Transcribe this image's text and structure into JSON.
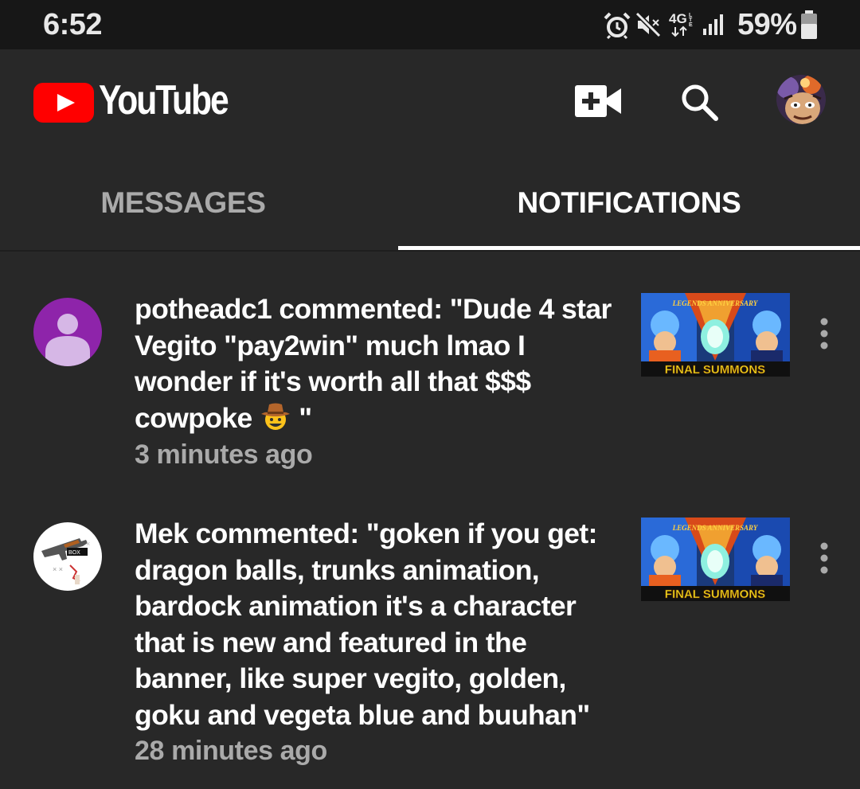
{
  "status_bar": {
    "time": "6:52",
    "network": "4G",
    "battery": "59%",
    "icons": [
      "alarm-icon",
      "mute-icon",
      "lte-icon",
      "signal-icon",
      "battery-icon"
    ]
  },
  "app_bar": {
    "brand": "YouTube",
    "icons": [
      "create-video-icon",
      "search-icon",
      "account-avatar"
    ]
  },
  "tabs": [
    {
      "label": "MESSAGES",
      "selected": false
    },
    {
      "label": "NOTIFICATIONS",
      "selected": true
    }
  ],
  "notifications": [
    {
      "text": "potheadc1 commented: \"Dude 4 star Vegito \"pay2win\" much lmao I wonder if it's worth all that $$$ cowpoke",
      "text_suffix": " \"",
      "emoji": "cowboy-face-emoji",
      "time": "3 minutes ago",
      "thumbnail_caption": "FINAL SUMMONS",
      "thumbnail_logo": "LEGENDS ANNIVERSARY"
    },
    {
      "text": "Mek commented: \"goken if you get: dragon balls, trunks animation, bardock animation it's a character that is new and featured in the banner, like super vegito, golden, goku and vegeta blue and buuhan\"",
      "time": "28 minutes ago",
      "thumbnail_caption": "FINAL SUMMONS",
      "thumbnail_logo": "LEGENDS ANNIVERSARY"
    }
  ],
  "colors": {
    "background": "#282828",
    "status_bar": "#171717",
    "youtube_red": "#ff0000",
    "secondary_text": "#aaaaaa",
    "default_avatar": "#8e24aa"
  }
}
